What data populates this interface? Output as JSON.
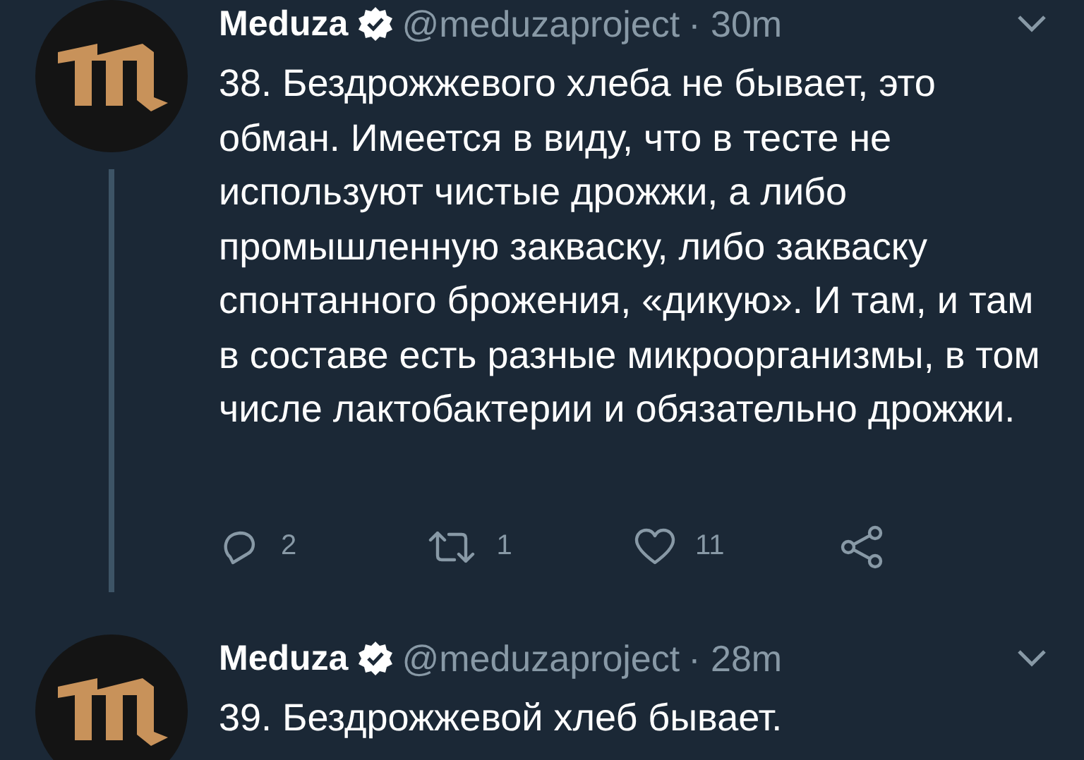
{
  "tweets": [
    {
      "name": "Meduza",
      "verified": true,
      "handle": "@meduzaproject",
      "time": "· 30m",
      "text": "38. Бездрожжевого хлеба не бывает, это обман. Имеется в виду, что в тесте не используют чистые дрожжи, а либо промышленную закваску, либо закваску спонтанного брожения, «дикую». И там, и там в составе есть разные микроорганизмы, в том числе лактобактерии и обязательно дрожжи.",
      "thread_continues": true,
      "actions": [
        {
          "kind": "reply",
          "count": "2"
        },
        {
          "kind": "retweet",
          "count": "1"
        },
        {
          "kind": "like",
          "count": "11"
        },
        {
          "kind": "share"
        }
      ]
    },
    {
      "name": "Meduza",
      "verified": true,
      "handle": "@meduzaproject",
      "time": "· 28m",
      "text": "39. Бездрожжевой хлеб бывает."
    }
  ]
}
